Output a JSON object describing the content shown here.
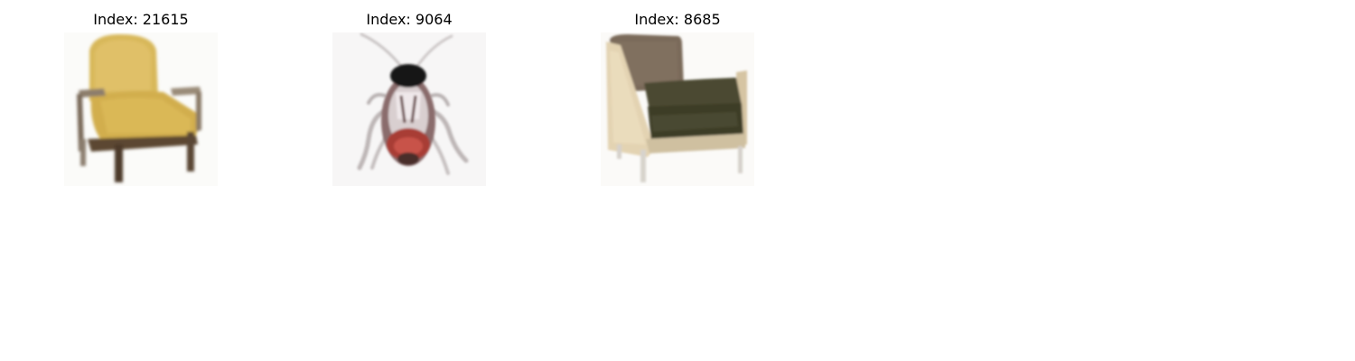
{
  "panels": [
    {
      "title": "Index: 21615",
      "subject": "yellow-armchair-image"
    },
    {
      "title": "Index: 9064",
      "subject": "cockroach-image"
    },
    {
      "title": "Index: 8685",
      "subject": "brown-armchair-image"
    }
  ],
  "colors": {
    "background": "#ffffff",
    "text": "#000000"
  }
}
